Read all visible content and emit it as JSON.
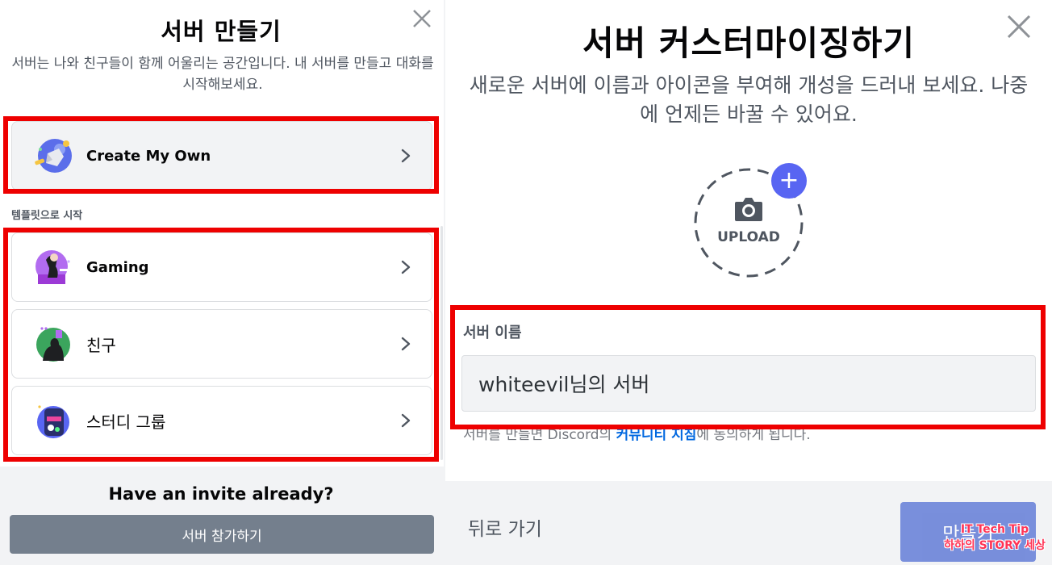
{
  "left": {
    "title": "서버 만들기",
    "description": "서버는 나와 친구들이 함께 어울리는 공간입니다. 내 서버를 만들고 대화를 시작해보세요.",
    "create_own": {
      "label": "Create My Own",
      "icon": "create-server-illustration"
    },
    "section_label": "템플릿으로 시작",
    "templates": [
      {
        "label": "Gaming",
        "icon": "gaming-illustration"
      },
      {
        "label": "친구",
        "icon": "friends-illustration"
      },
      {
        "label": "스터디 그룹",
        "icon": "study-group-illustration"
      }
    ],
    "footer": {
      "title": "Have an invite already?",
      "join_button": "서버 참가하기"
    }
  },
  "right": {
    "title": "서버 커스터마이징하기",
    "description": "새로운 서버에 이름과 아이콘을 부여해 개성을 드러내 보세요. 나중에 언제든 바꿀 수 있어요.",
    "upload": {
      "label": "UPLOAD",
      "icon": "camera-icon"
    },
    "field": {
      "label": "서버 이름",
      "value": "whiteevil님의 서버"
    },
    "terms": {
      "prefix": "서버를 만들면 Discord의 ",
      "link": "커뮤니티 지침",
      "suffix": "에 동의하게 됩니다."
    },
    "footer": {
      "back": "뒤로 가기",
      "create": "만들기"
    }
  },
  "watermark": {
    "line1": "IT Tech Tip",
    "line2": "하하의 STORY 세상"
  },
  "colors": {
    "highlight": "#ee0000",
    "primary_button": "#7289da",
    "secondary_button": "#747f8d",
    "link": "#0068e0"
  }
}
